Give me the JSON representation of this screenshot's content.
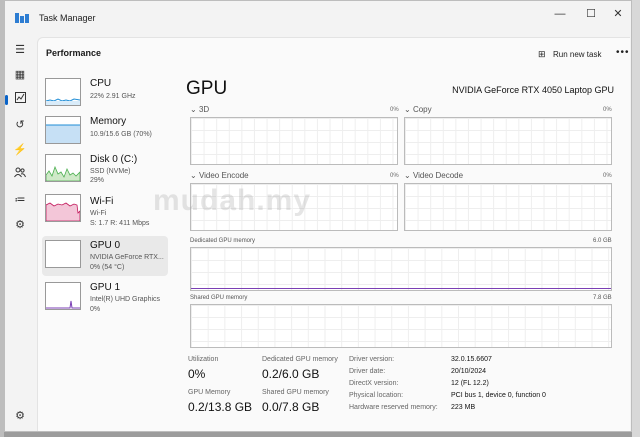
{
  "window": {
    "title": "Task Manager",
    "controls": {
      "minimize": "—",
      "maximize": "☐",
      "close": "✕"
    }
  },
  "header": {
    "section": "Performance",
    "run_new_task": "Run new task",
    "more": "•••"
  },
  "sidebar_icons": [
    "hamburger-icon",
    "processes-icon",
    "performance-icon",
    "history-icon",
    "startup-icon",
    "users-icon",
    "details-icon",
    "services-icon",
    "settings-icon"
  ],
  "devices": [
    {
      "name": "CPU",
      "sub1": "22% 2.91 GHz",
      "sub2": "",
      "color": "#1f8dd6"
    },
    {
      "name": "Memory",
      "sub1": "10.9/15.6 GB (70%)",
      "sub2": "",
      "color": "#1f8dd6"
    },
    {
      "name": "Disk 0 (C:)",
      "sub1": "SSD (NVMe)",
      "sub2": "29%",
      "color": "#4caf50"
    },
    {
      "name": "Wi-Fi",
      "sub1": "Wi-Fi",
      "sub2": "S: 1.7  R: 411 Mbps",
      "color": "#c2185b"
    },
    {
      "name": "GPU 0",
      "sub1": "NVIDIA GeForce RTX...",
      "sub2": "0% (54 °C)",
      "color": "#7b3fb5"
    },
    {
      "name": "GPU 1",
      "sub1": "Intel(R) UHD Graphics",
      "sub2": "0%",
      "color": "#7b3fb5"
    }
  ],
  "gpu": {
    "title": "GPU",
    "model": "NVIDIA GeForce RTX 4050 Laptop GPU",
    "engines": [
      {
        "label": "3D",
        "pct": "0%"
      },
      {
        "label": "Copy",
        "pct": "0%"
      },
      {
        "label": "Video Encode",
        "pct": "0%"
      },
      {
        "label": "Video Decode",
        "pct": "0%"
      }
    ],
    "dedicated": {
      "label": "Dedicated GPU memory",
      "max": "6.0 GB"
    },
    "shared": {
      "label": "Shared GPU memory",
      "max": "7.8 GB"
    },
    "stats": {
      "utilization_label": "Utilization",
      "utilization": "0%",
      "dedicated_label": "Dedicated GPU memory",
      "dedicated": "0.2/6.0 GB",
      "gpu_memory_label": "GPU Memory",
      "gpu_memory": "0.2/13.8 GB",
      "shared_label": "Shared GPU memory",
      "shared": "0.0/7.8 GB"
    },
    "info": [
      {
        "k": "Driver version:",
        "v": "32.0.15.6607"
      },
      {
        "k": "Driver date:",
        "v": "20/10/2024"
      },
      {
        "k": "DirectX version:",
        "v": "12 (FL 12.2)"
      },
      {
        "k": "Physical location:",
        "v": "PCI bus 1, device 0, function 0"
      },
      {
        "k": "Hardware reserved memory:",
        "v": "223 MB"
      }
    ]
  },
  "watermark": "mudah.my"
}
